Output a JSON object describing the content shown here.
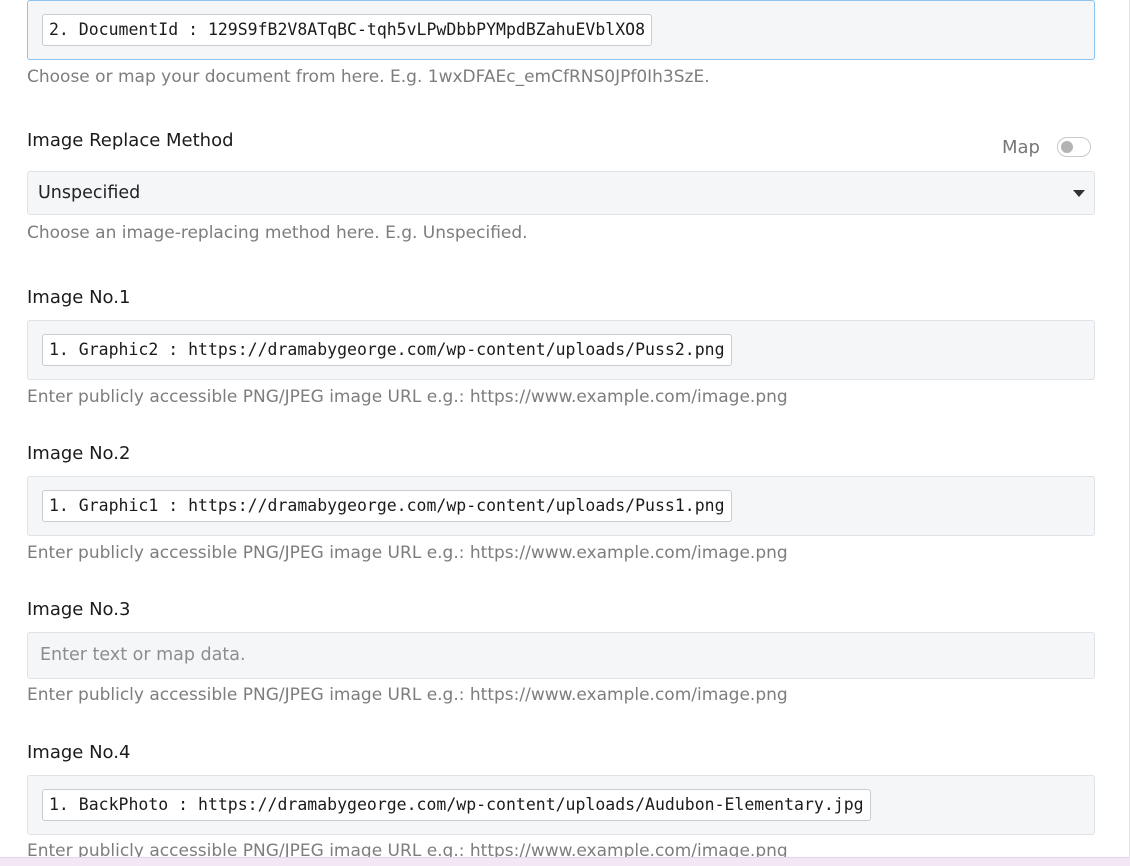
{
  "document_field": {
    "chip": "2. DocumentId : 129S9fB2V8ATqBC-tqh5vLPwDbbPYMpdBZahuEVblXO8",
    "helper": "Choose or map your document from here. E.g. 1wxDFAEc_emCfRNS0JPf0Ih3SzE."
  },
  "image_replace_method": {
    "label": "Image Replace Method",
    "map_label": "Map",
    "map_toggle_on": false,
    "selected_value": "Unspecified",
    "helper": "Choose an image-replacing method here. E.g. Unspecified."
  },
  "images": [
    {
      "label": "Image No.1",
      "chip": "1. Graphic2 : https://dramabygeorge.com/wp-content/uploads/Puss2.png",
      "helper": "Enter publicly accessible PNG/JPEG image URL e.g.: https://www.example.com/image.png"
    },
    {
      "label": "Image No.2",
      "chip": "1. Graphic1 : https://dramabygeorge.com/wp-content/uploads/Puss1.png",
      "helper": "Enter publicly accessible PNG/JPEG image URL e.g.: https://www.example.com/image.png"
    },
    {
      "label": "Image No.3",
      "placeholder": "Enter text or map data.",
      "helper": "Enter publicly accessible PNG/JPEG image URL e.g.: https://www.example.com/image.png"
    },
    {
      "label": "Image No.4",
      "chip": "1. BackPhoto : https://dramabygeorge.com/wp-content/uploads/Audubon-Elementary.jpg",
      "helper": "Enter publicly accessible PNG/JPEG image URL e.g.: https://www.example.com/image.png"
    }
  ],
  "colors": {
    "field_background": "#f4f6f8",
    "field_border": "#dfe3e8",
    "focused_border": "#8cc3f0",
    "helper_text": "#7d7d7d"
  }
}
